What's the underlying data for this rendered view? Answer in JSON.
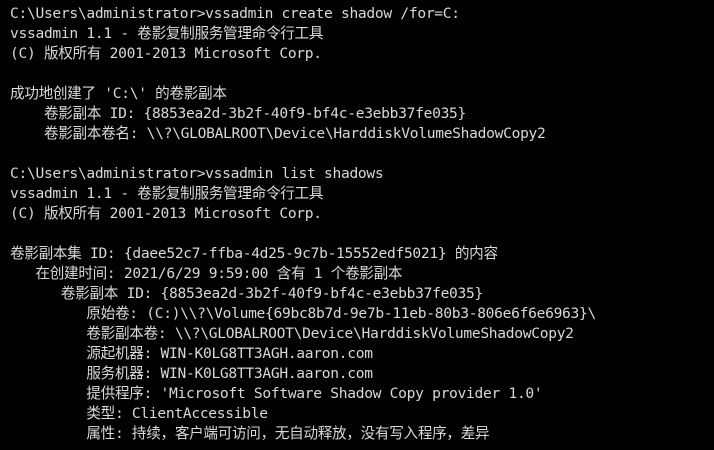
{
  "console": {
    "background_color": "#000000",
    "text_color": "#d9d9d9",
    "lines": [
      "C:\\Users\\administrator>vssadmin create shadow /for=C:",
      "vssadmin 1.1 - 卷影复制服务管理命令行工具",
      "(C) 版权所有 2001-2013 Microsoft Corp.",
      "",
      "成功地创建了 'C:\\' 的卷影副本",
      "    卷影副本 ID: {8853ea2d-3b2f-40f9-bf4c-e3ebb37fe035}",
      "    卷影副本卷名: \\\\?\\GLOBALROOT\\Device\\HarddiskVolumeShadowCopy2",
      "",
      "C:\\Users\\administrator>vssadmin list shadows",
      "vssadmin 1.1 - 卷影复制服务管理命令行工具",
      "(C) 版权所有 2001-2013 Microsoft Corp.",
      "",
      "卷影副本集 ID: {daee52c7-ffba-4d25-9c7b-15552edf5021} 的内容",
      "   在创建时间: 2021/6/29 9:59:00 含有 1 个卷影副本",
      "      卷影副本 ID: {8853ea2d-3b2f-40f9-bf4c-e3ebb37fe035}",
      "         原始卷: (C:)\\\\?\\Volume{69bc8b7d-9e7b-11eb-80b3-806e6f6e6963}\\",
      "         卷影副本卷: \\\\?\\GLOBALROOT\\Device\\HarddiskVolumeShadowCopy2",
      "         源起机器: WIN-K0LG8TT3AGH.aaron.com",
      "         服务机器: WIN-K0LG8TT3AGH.aaron.com",
      "         提供程序: 'Microsoft Software Shadow Copy provider 1.0'",
      "         类型: ClientAccessible",
      "         属性: 持续，客户端可访问，无自动释放，没有写入程序，差异"
    ]
  }
}
